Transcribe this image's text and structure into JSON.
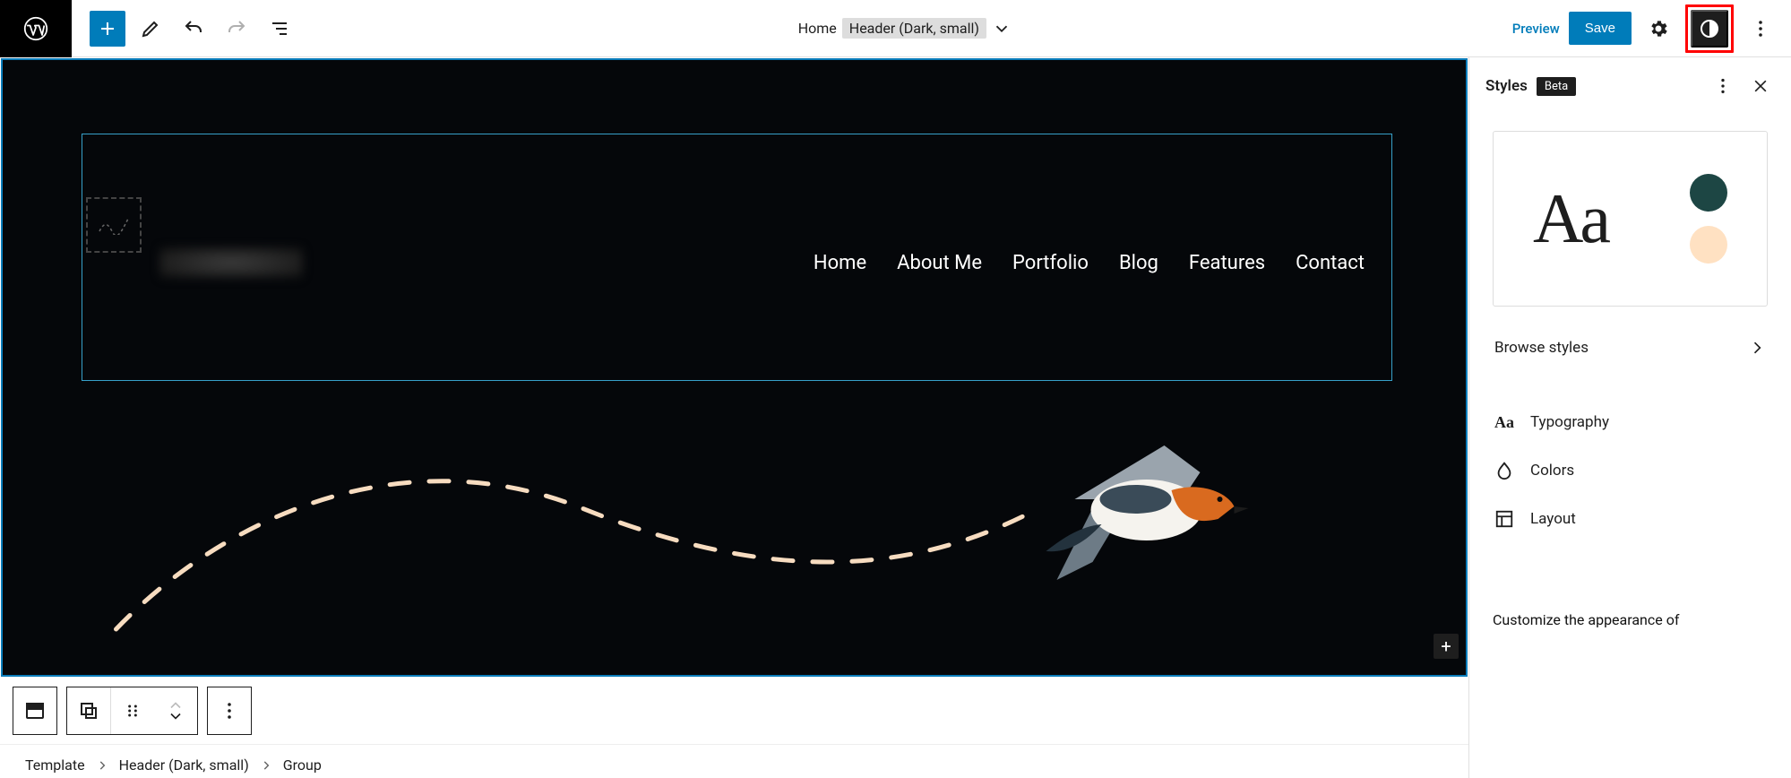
{
  "topbar": {
    "doc_name": "Home",
    "template_part": "Header (Dark, small)",
    "preview": "Preview",
    "save": "Save"
  },
  "nav_items": [
    "Home",
    "About Me",
    "Portfolio",
    "Blog",
    "Features",
    "Contact"
  ],
  "breadcrumb": {
    "template": "Template",
    "part": "Header (Dark, small)",
    "block": "Group"
  },
  "panel": {
    "title": "Styles",
    "badge": "Beta",
    "preview_text": "Aa",
    "swatch1": "#1d4644",
    "swatch2": "#ffe1c2",
    "browse": "Browse styles",
    "typography": "Typography",
    "colors": "Colors",
    "layout": "Layout",
    "customize_text": "Customize the appearance of"
  }
}
